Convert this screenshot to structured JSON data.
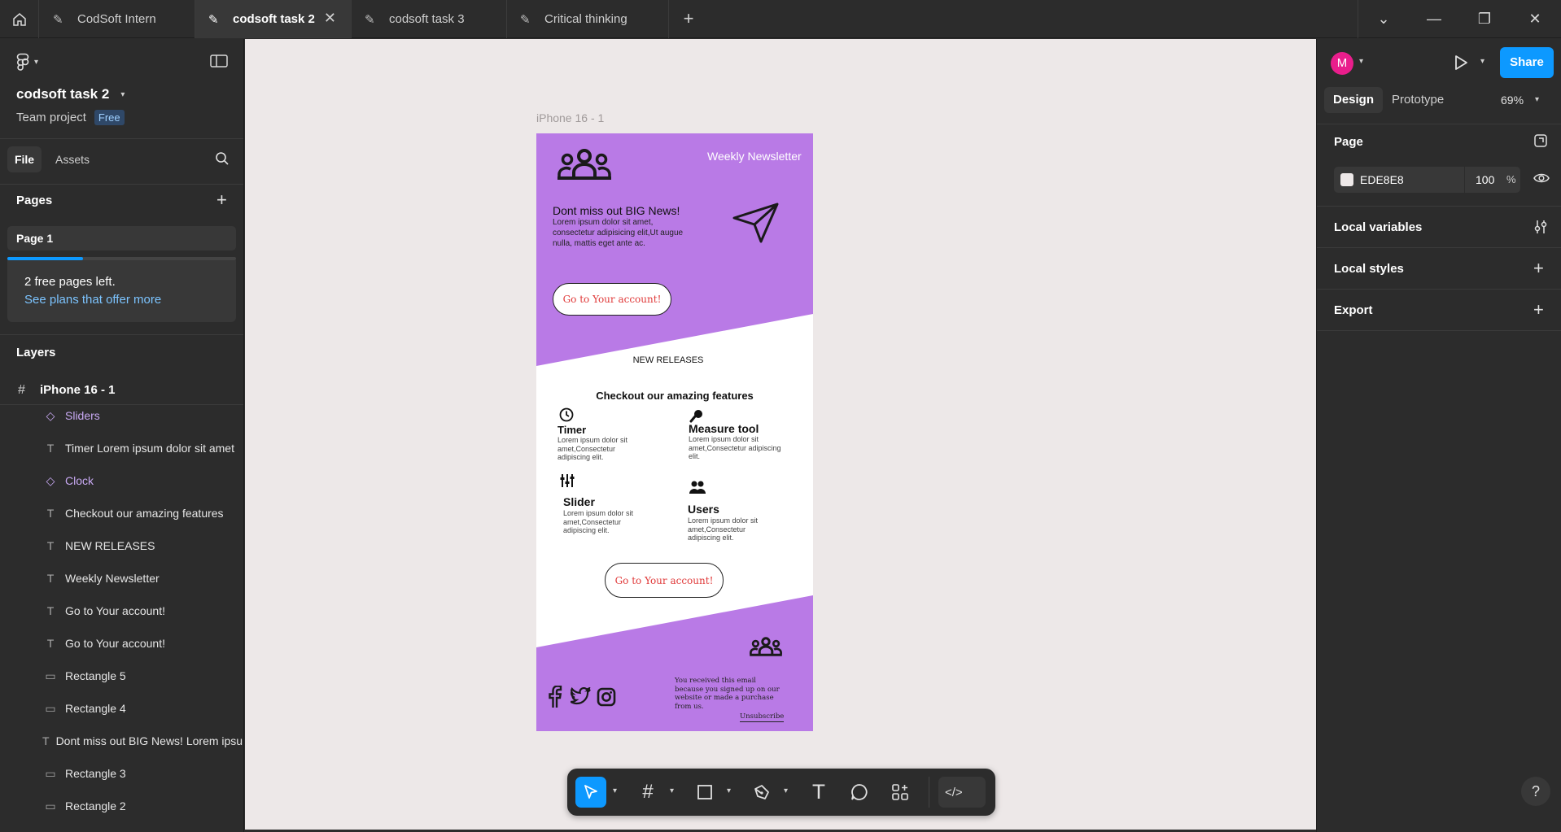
{
  "colors": {
    "accent": "#0d99ff",
    "frame_purple": "#b97ae6",
    "avatar": "#e91e8c",
    "component": "#c8a9f3",
    "cta_text": "#e03a3a",
    "canvas_bg": "#EDE8E8"
  },
  "tabs": [
    {
      "label": "CodSoft Intern",
      "active": false
    },
    {
      "label": "codsoft task 2",
      "active": true
    },
    {
      "label": "codsoft task 3",
      "active": false
    },
    {
      "label": "Critical thinking",
      "active": false
    }
  ],
  "file": {
    "name": "codsoft task 2",
    "team": "Team project",
    "plan_badge": "Free"
  },
  "left_tabs": {
    "file": "File",
    "assets": "Assets"
  },
  "pages": {
    "heading": "Pages",
    "items": [
      "Page 1"
    ],
    "notice": "2 free pages left.",
    "notice_link": "See plans that offer more",
    "usage_fraction": 0.33
  },
  "layers": {
    "heading": "Layers",
    "frame": "iPhone 16 - 1",
    "items": [
      {
        "label": "Sliders",
        "icon": "component-icon",
        "glyph": "◇",
        "component": true
      },
      {
        "label": "Timer Lorem ipsum dolor sit amet",
        "icon": "text-layer-icon",
        "glyph": "T",
        "component": false
      },
      {
        "label": "Clock",
        "icon": "component-icon",
        "glyph": "◇",
        "component": true
      },
      {
        "label": "Checkout our amazing features",
        "icon": "text-layer-icon",
        "glyph": "T",
        "component": false
      },
      {
        "label": "NEW RELEASES",
        "icon": "text-layer-icon",
        "glyph": "T",
        "component": false
      },
      {
        "label": "Weekly Newsletter",
        "icon": "text-layer-icon",
        "glyph": "T",
        "component": false
      },
      {
        "label": "Go to Your account!",
        "icon": "text-layer-icon",
        "glyph": "T",
        "component": false
      },
      {
        "label": "Go to Your account!",
        "icon": "text-layer-icon",
        "glyph": "T",
        "component": false
      },
      {
        "label": "Rectangle 5",
        "icon": "rectangle-icon",
        "glyph": "▭",
        "component": false
      },
      {
        "label": "Rectangle 4",
        "icon": "rectangle-icon",
        "glyph": "▭",
        "component": false
      },
      {
        "label": "Dont miss out BIG News! Lorem ipsum",
        "icon": "text-layer-icon",
        "glyph": "T",
        "component": false
      },
      {
        "label": "Rectangle 3",
        "icon": "rectangle-icon",
        "glyph": "▭",
        "component": false
      },
      {
        "label": "Rectangle 2",
        "icon": "rectangle-icon",
        "glyph": "▭",
        "component": false
      }
    ]
  },
  "canvas": {
    "frame_label": "iPhone 16 - 1",
    "newsletter": {
      "weekly": "Weekly Newsletter",
      "headline": "Dont miss out BIG News!",
      "body": "Lorem ipsum dolor sit amet, consectetur adipisicing elit,Ut augue nulla, mattis eget ante ac.",
      "cta_top": "Go to Your account!",
      "new_releases": "NEW RELEASES",
      "features_title": "Checkout our amazing features",
      "features": [
        {
          "title": "Timer",
          "desc": "Lorem ipsum dolor sit amet,Consectetur adipiscing elit.",
          "icon": "clock-icon"
        },
        {
          "title": "Measure tool",
          "desc": "Lorem ipsum dolor sit amet,Consectetur adipiscing elit.",
          "icon": "measure-icon"
        },
        {
          "title": "Slider",
          "desc": "Lorem ipsum dolor sit amet,Consectetur adipiscing elit.",
          "icon": "sliders-icon"
        },
        {
          "title": "Users",
          "desc": "Lorem ipsum dolor sit amet,Consectetur adipiscing elit.",
          "icon": "users-icon"
        }
      ],
      "cta_bottom": "Go to Your account!",
      "footer_text": "You received this email because you  signed up on our website or made a purchase from us.",
      "unsubscribe": "Unsubscribe"
    }
  },
  "right_panel": {
    "avatar_letter": "M",
    "share": "Share",
    "tabs": {
      "design": "Design",
      "prototype": "Prototype"
    },
    "zoom": "69%",
    "page_label": "Page",
    "page_color_hex": "EDE8E8",
    "page_opacity": "100",
    "percent_sign": "%",
    "local_variables": "Local variables",
    "local_styles": "Local styles",
    "export": "Export",
    "help": "?"
  }
}
